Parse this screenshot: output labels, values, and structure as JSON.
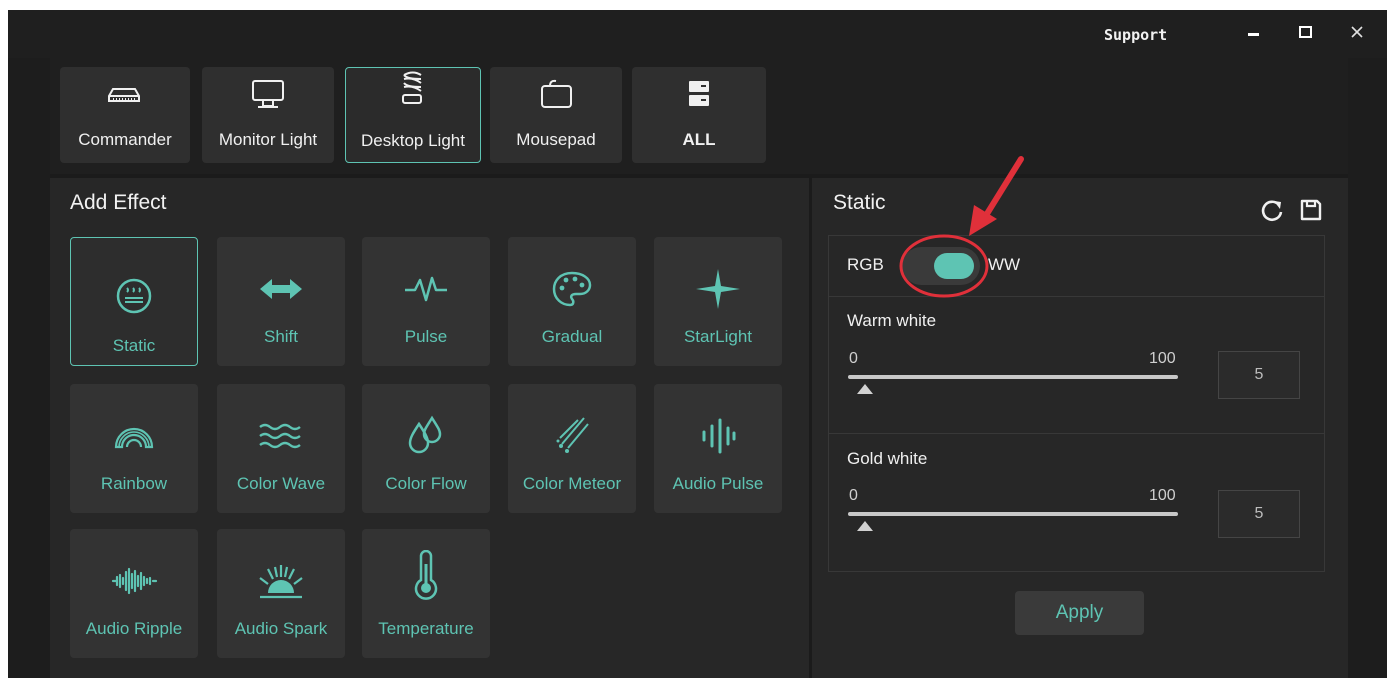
{
  "window": {
    "support_label": "Support"
  },
  "devices": [
    {
      "label": "Commander",
      "icon": "commander-icon",
      "active": false
    },
    {
      "label": "Monitor Light",
      "icon": "monitor-icon",
      "active": false
    },
    {
      "label": "Desktop Light",
      "icon": "desktop-light-icon",
      "active": true
    },
    {
      "label": "Mousepad",
      "icon": "mousepad-icon",
      "active": false
    },
    {
      "label": "ALL",
      "icon": "all-devices-icon",
      "active": false
    }
  ],
  "effects": {
    "title": "Add Effect",
    "items": [
      {
        "label": "Static",
        "icon": "static-icon",
        "active": true
      },
      {
        "label": "Shift",
        "icon": "shift-icon"
      },
      {
        "label": "Pulse",
        "icon": "pulse-icon"
      },
      {
        "label": "Gradual",
        "icon": "palette-icon"
      },
      {
        "label": "StarLight",
        "icon": "starlight-icon"
      },
      {
        "label": "Rainbow",
        "icon": "rainbow-icon"
      },
      {
        "label": "Color Wave",
        "icon": "color-wave-icon"
      },
      {
        "label": "Color Flow",
        "icon": "color-flow-icon"
      },
      {
        "label": "Color Meteor",
        "icon": "meteor-icon"
      },
      {
        "label": "Audio Pulse",
        "icon": "audio-pulse-icon"
      },
      {
        "label": "Audio Ripple",
        "icon": "audio-ripple-icon"
      },
      {
        "label": "Audio Spark",
        "icon": "audio-spark-icon"
      },
      {
        "label": "Temperature",
        "icon": "thermometer-icon"
      }
    ]
  },
  "settings": {
    "title": "Static",
    "mode_left": "RGB",
    "mode_right": "WW",
    "mode_toggle_on": true,
    "warm": {
      "label": "Warm white",
      "min": "0",
      "max": "100",
      "value": "5"
    },
    "gold": {
      "label": "Gold white",
      "min": "0",
      "max": "100",
      "value": "5"
    },
    "apply_label": "Apply"
  },
  "colors": {
    "accent": "#5ec4b3",
    "annotation": "#e0303a",
    "background": "#272727"
  }
}
